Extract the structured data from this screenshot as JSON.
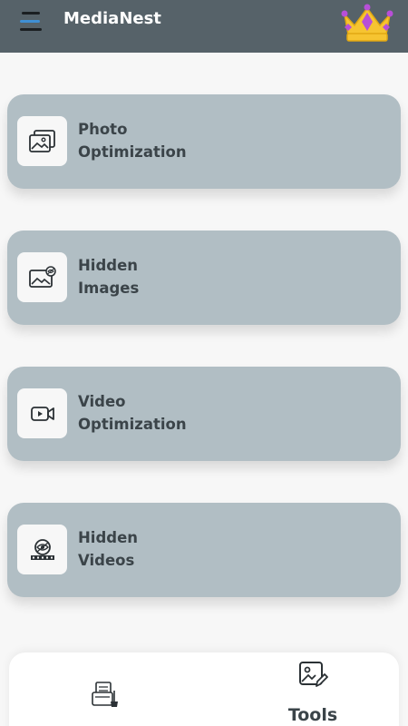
{
  "header": {
    "title": "MediaNest",
    "menu_icon": "hamburger-menu-icon",
    "premium_icon": "crown-icon"
  },
  "tools": [
    {
      "label": "Photo\nOptimization",
      "icon": "photo-gallery-icon"
    },
    {
      "label": "Hidden\nImages",
      "icon": "hidden-image-icon"
    },
    {
      "label": "Video\nOptimization",
      "icon": "video-camera-icon"
    },
    {
      "label": "Hidden\nVideos",
      "icon": "hidden-video-icon"
    }
  ],
  "bottom_nav": {
    "items": [
      {
        "label": "",
        "icon": "files-cleaner-icon",
        "active": false
      },
      {
        "label": "Tools",
        "icon": "image-edit-icon",
        "active": true
      }
    ]
  },
  "colors": {
    "appbar": "#566269",
    "card": "#b1bec4",
    "text": "#3b4449",
    "crown": "#f6c431",
    "crown_jewel": "#b84fd8",
    "menu_accent": "#3f8fd4"
  }
}
